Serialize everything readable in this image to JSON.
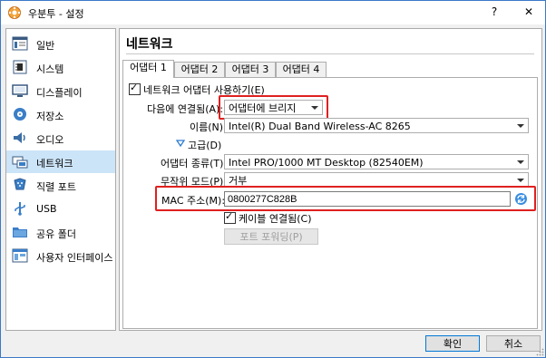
{
  "window": {
    "title": "우분투 - 설정",
    "help": "?",
    "close": "✕"
  },
  "sidebar": {
    "items": [
      {
        "label": "일반",
        "icon": "general-icon"
      },
      {
        "label": "시스템",
        "icon": "system-icon"
      },
      {
        "label": "디스플레이",
        "icon": "display-icon"
      },
      {
        "label": "저장소",
        "icon": "storage-icon"
      },
      {
        "label": "오디오",
        "icon": "audio-icon"
      },
      {
        "label": "네트워크",
        "icon": "network-icon",
        "selected": true
      },
      {
        "label": "직렬 포트",
        "icon": "serial-port-icon"
      },
      {
        "label": "USB",
        "icon": "usb-icon"
      },
      {
        "label": "공유 폴더",
        "icon": "shared-folder-icon"
      },
      {
        "label": "사용자 인터페이스",
        "icon": "user-interface-icon"
      }
    ]
  },
  "main": {
    "section_title": "네트워크",
    "tabs": [
      "어댑터 1",
      "어댑터 2",
      "어댑터 3",
      "어댑터 4"
    ],
    "active_tab": 0,
    "enable_adapter": {
      "label": "네트워크 어댑터 사용하기(E)",
      "checked": true
    },
    "attached_to": {
      "label": "다음에 연결됨(A):",
      "value": "어댑터에 브리지"
    },
    "name": {
      "label": "이름(N):",
      "value": "Intel(R) Dual Band Wireless-AC 8265"
    },
    "advanced": {
      "label": "고급(D)"
    },
    "adapter_type": {
      "label": "어댑터 종류(T):",
      "value": "Intel PRO/1000 MT Desktop (82540EM)"
    },
    "promiscuous": {
      "label": "무작위 모드(P):",
      "value": "거부"
    },
    "mac": {
      "label": "MAC 주소(M):",
      "value": "0800277C828B"
    },
    "cable": {
      "label": "케이블 연결됨(C)",
      "checked": true
    },
    "port_forwarding": {
      "label": "포트 포워딩(P)"
    }
  },
  "footer": {
    "ok": "확인",
    "cancel": "취소"
  },
  "colors": {
    "highlight": "#e02020",
    "selection": "#cce4f7",
    "accent": "#0078d7"
  }
}
